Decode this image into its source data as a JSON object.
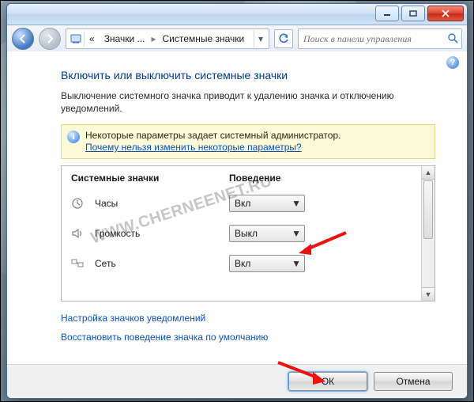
{
  "breadcrumb": {
    "seg1": "Значки ...",
    "seg2": "Системные значки"
  },
  "search": {
    "placeholder": "Поиск в панели управления"
  },
  "heading": "Включить или выключить системные значки",
  "description": "Выключение системного значка приводит к удалению значка и отключению уведомлений.",
  "infobox": {
    "line1": "Некоторые параметры задает системный администратор.",
    "link": "Почему нельзя изменить некоторые параметры?"
  },
  "columns": {
    "c1": "Системные значки",
    "c2": "Поведение"
  },
  "options": {
    "on": "Вкл",
    "off": "Выкл"
  },
  "rows": [
    {
      "label": "Часы",
      "value_key": "on"
    },
    {
      "label": "Громкость",
      "value_key": "off"
    },
    {
      "label": "Сеть",
      "value_key": "on"
    }
  ],
  "links": {
    "customize": "Настройка значков уведомлений",
    "restore": "Восстановить поведение значка по умолчанию"
  },
  "buttons": {
    "ok": "ОК",
    "cancel": "Отмена"
  },
  "watermark": "WWW.CHERNEENET.RU"
}
